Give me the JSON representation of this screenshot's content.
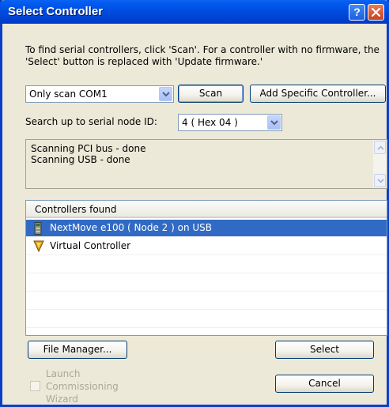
{
  "window": {
    "title": "Select Controller",
    "help_glyph": "?"
  },
  "message": "To find serial controllers, click 'Scan'.  For a controller with no firmware, the 'Select' button is replaced with 'Update firmware.'",
  "scan_row": {
    "scan_mode_value": "Only scan COM1",
    "scan_button": "Scan",
    "add_button": "Add Specific Controller..."
  },
  "node_row": {
    "label": "Search up to serial node ID:",
    "value": "4  ( Hex 04 )"
  },
  "status": {
    "lines": [
      "Scanning PCI bus - done",
      "Scanning USB - done"
    ]
  },
  "controllers": {
    "header": "Controllers found",
    "items": [
      {
        "label": "NextMove e100 ( Node 2 ) on USB",
        "icon": "controller-board-icon",
        "selected": true
      },
      {
        "label": "Virtual Controller",
        "icon": "virtual-controller-icon",
        "selected": false
      }
    ]
  },
  "buttons": {
    "file_manager": "File Manager...",
    "select": "Select",
    "cancel": "Cancel"
  },
  "launch_wizard": {
    "label": "Launch Commissioning Wizard",
    "checked": false,
    "enabled": false
  },
  "colors": {
    "title_bar": "#0054e3",
    "selection": "#316ac5",
    "dialog_bg": "#ece9d8"
  }
}
